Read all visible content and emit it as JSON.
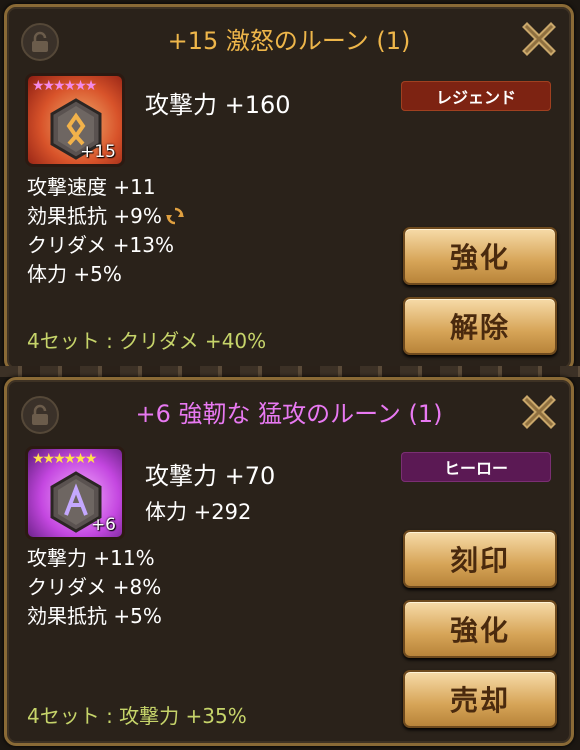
{
  "rune1": {
    "title": "+15 激怒のルーン (1)",
    "stars": "★★★★★★",
    "level": "+15",
    "main_stat": "攻撃力 +160",
    "grade": "レジェンド",
    "substats": [
      "攻撃速度 +11",
      "効果抵抗 +9%",
      "クリダメ +13%",
      "体力 +5%"
    ],
    "set_bonus": "4セット : クリダメ +40%",
    "buttons": {
      "enhance": "強化",
      "remove": "解除"
    },
    "icons": [
      "lock-icon",
      "close-icon",
      "reapply-icon"
    ],
    "accent": "#eeb64a"
  },
  "rune2": {
    "title": "+6 強靭な 猛攻のルーン (1)",
    "stars": "★★★★★★",
    "level": "+6",
    "main_stat": "攻撃力 +70",
    "prefix_stat": "体力 +292",
    "grade": "ヒーロー",
    "substats": [
      "攻撃力 +11%",
      "クリダメ +8%",
      "効果抵抗 +5%"
    ],
    "set_bonus": "4セット : 攻撃力 +35%",
    "buttons": {
      "engrave": "刻印",
      "enhance": "強化",
      "sell": "売却"
    },
    "icons": [
      "lock-icon",
      "close-icon"
    ],
    "accent": "#e879f2"
  }
}
